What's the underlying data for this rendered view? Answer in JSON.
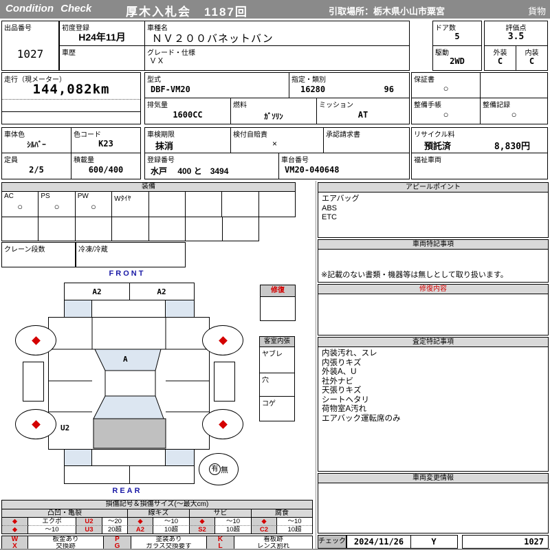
{
  "header": {
    "brand": "Condition  Check",
    "auction_title": "厚木入札会　1187回",
    "pickup_location": "引取場所：栃木県小山市粟宮",
    "category": "貨物"
  },
  "vehicle": {
    "lot": {
      "label": "出品番号",
      "value": "1027"
    },
    "first_registration": {
      "label": "初度登録",
      "value": "H24年11月"
    },
    "history": {
      "label": "車歴",
      "value": ""
    },
    "model_name": {
      "label": "車種名",
      "value": "ＮＶ２００バネットバン"
    },
    "grade": {
      "label": "グレード・仕様",
      "value": "ＶＸ"
    },
    "doors": {
      "label": "ドア数",
      "value": "5"
    },
    "drive": {
      "label": "駆動",
      "value": "2WD"
    },
    "score": {
      "label": "評価点",
      "value": "3.5"
    },
    "exterior": {
      "label": "外装",
      "value": "C"
    },
    "interior": {
      "label": "内装",
      "value": "C"
    },
    "mileage": {
      "label": "走行（現メーター）",
      "value": "144,082km"
    },
    "model_code": {
      "label": "型式",
      "value": "DBF-VM20"
    },
    "type_class": {
      "label": "指定・類別",
      "type": "16280",
      "class": "96"
    },
    "displacement": {
      "label": "排気量",
      "value": "1600CC"
    },
    "fuel": {
      "label": "燃料",
      "value": "ｶﾞｿﾘﾝ"
    },
    "mission": {
      "label": "ミッション",
      "value": "AT"
    },
    "warranty": {
      "label": "保証書",
      "value": "○"
    },
    "maintenance_book": {
      "label": "整備手帳",
      "value": "○"
    },
    "maintenance_record": {
      "label": "整備記録",
      "value": "○"
    },
    "body_color": {
      "label": "車体色",
      "value": "ｼﾙﾊﾞｰ"
    },
    "color_code": {
      "label": "色コード",
      "value": "K23"
    },
    "inspection": {
      "label": "車検期限",
      "value": "抹消"
    },
    "insurance": {
      "label": "検付自賠責",
      "value": "×"
    },
    "approval": {
      "label": "承認請求書",
      "value": ""
    },
    "recycle": {
      "label": "リサイクル料",
      "status": "預託済",
      "fee": "8,830円"
    },
    "capacity": {
      "label": "定員",
      "value": "2/5"
    },
    "load": {
      "label": "積載量",
      "value": "600/400"
    },
    "registration": {
      "label": "登録番号",
      "value": "水戸　 400 と　3494"
    },
    "chassis": {
      "label": "車台番号",
      "value": "VM20-040648"
    },
    "welfare": {
      "label": "福祉車両",
      "value": ""
    }
  },
  "equipment": {
    "title": "装備",
    "cells": [
      {
        "label": "AC",
        "mark": "○"
      },
      {
        "label": "PS",
        "mark": "○"
      },
      {
        "label": "PW",
        "mark": "○"
      },
      {
        "label": "Wﾀｲﾔ",
        "mark": ""
      }
    ],
    "crane": {
      "label": "クレーン段数",
      "value": ""
    },
    "reefer": {
      "label": "冷凍/冷蔵",
      "value": ""
    }
  },
  "panels": {
    "appeal": {
      "title": "アピールポイント",
      "lines": [
        "エアバッグ",
        "ABS",
        "ETC"
      ]
    },
    "special_notes": {
      "title": "車両特記事項",
      "note": "※記載のない書類・機器等は無しとして取り扱います。"
    },
    "repair_detail": {
      "title": "修復内容"
    },
    "assessment": {
      "title": "査定特記事項",
      "lines": [
        "内装汚れ、スレ",
        "内張りキズ",
        "外装A、U",
        "社外ナビ",
        "天張りキズ",
        "シートヘタリ",
        "荷物室A汚れ",
        "エアバック運転席のみ"
      ]
    },
    "change_info": {
      "title": "車両変更情報"
    },
    "check": {
      "label": "チェック",
      "date": "2024/11/26",
      "code": "Y",
      "number": "1027"
    }
  },
  "diagram": {
    "front_label": "FRONT",
    "rear_label": "REAR",
    "marks": {
      "front_bumper_left": "A2",
      "front_bumper_right": "A2",
      "windshield": "A",
      "rear_left_panel": "U2"
    },
    "repair_flag": {
      "title": "修復"
    },
    "cabin_lining": {
      "title": "客室内張",
      "items": [
        "ヤブレ",
        "穴",
        "コゲ"
      ]
    },
    "presence": {
      "yes": "有",
      "no": "無"
    }
  },
  "legend": {
    "title": "損傷記号＆損傷サイズ(〜最大cm)",
    "groups": [
      "凸凹・亀裂",
      "線キズ",
      "サビ",
      "腐食"
    ],
    "rows": [
      [
        "◆",
        "エクボ",
        "U2",
        "〜20",
        "◆",
        "〜10",
        "◆",
        "〜10",
        "◆",
        "〜10"
      ],
      [
        "◆",
        "〜10",
        "U3",
        "20超",
        "A2",
        "10超",
        "S2",
        "10超",
        "C2",
        "10超"
      ]
    ],
    "codes": [
      {
        "letter": "W",
        "desc": "板金あり"
      },
      {
        "letter": "P",
        "desc": "塗装あり"
      },
      {
        "letter": "K",
        "desc": "看板跡"
      },
      {
        "letter": "X",
        "desc": "交換跡"
      },
      {
        "letter": "G",
        "desc": "ガラス交換要す"
      },
      {
        "letter": "L",
        "desc": "レンズ割れ"
      }
    ]
  },
  "colors": {
    "header_gray": "#8a8a8a",
    "section_gray": "#d9d9d9",
    "accent_red": "#d40000",
    "diagram_blue": "#dce6f1",
    "diagram_gray": "#c0c0c0",
    "label_blue": "#1a1aa6"
  }
}
